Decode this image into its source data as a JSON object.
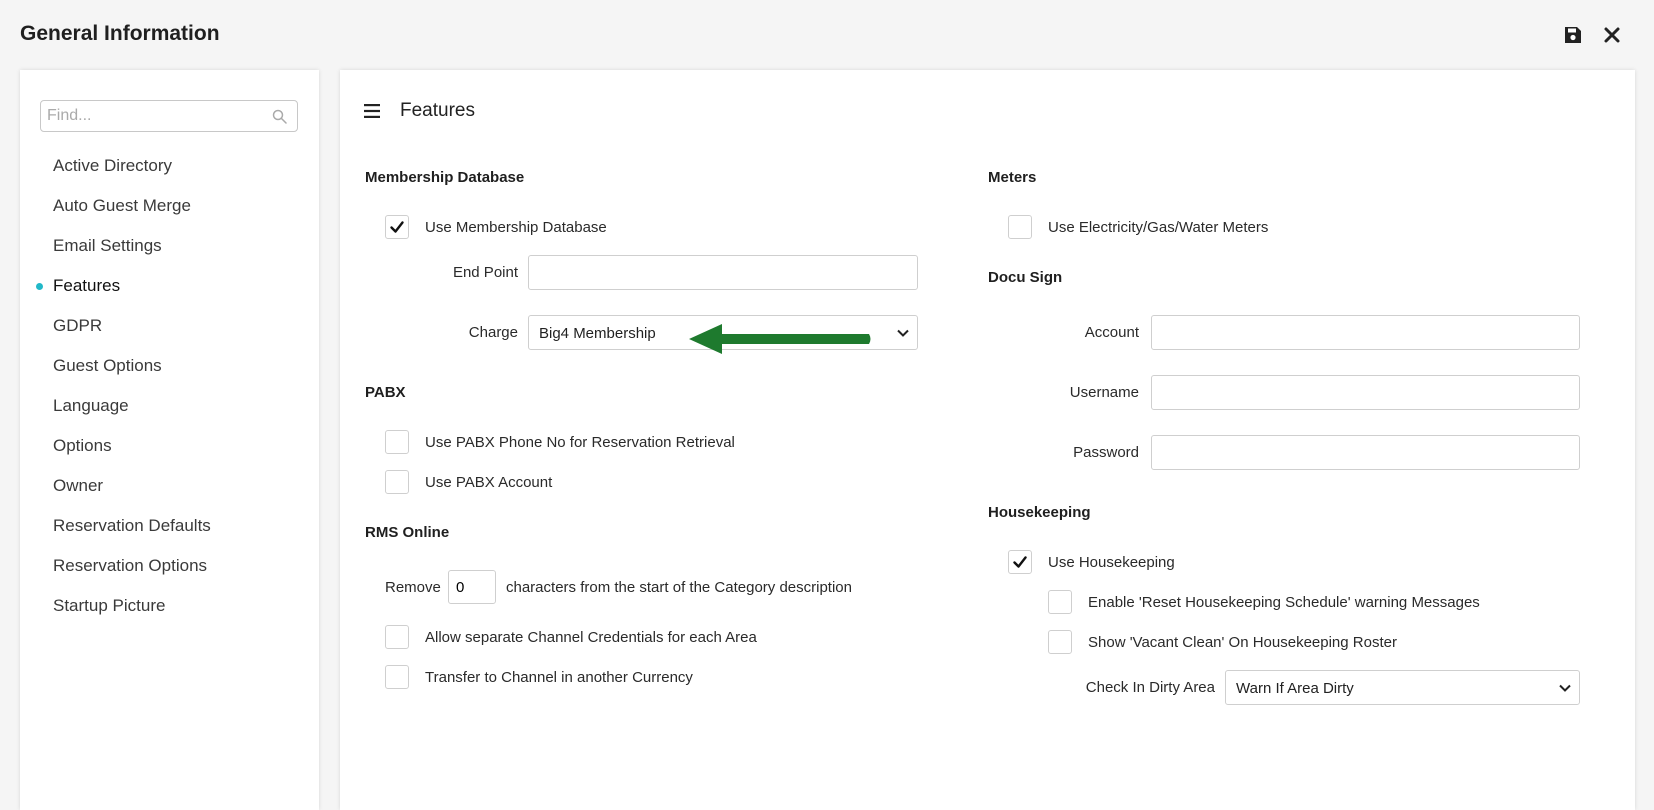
{
  "header": {
    "title": "General Information"
  },
  "sidebar": {
    "search_placeholder": "Find...",
    "items": [
      {
        "label": "Active Directory"
      },
      {
        "label": "Auto Guest Merge"
      },
      {
        "label": "Email Settings"
      },
      {
        "label": "Features",
        "active": true
      },
      {
        "label": "GDPR"
      },
      {
        "label": "Guest Options"
      },
      {
        "label": "Language"
      },
      {
        "label": "Options"
      },
      {
        "label": "Owner"
      },
      {
        "label": "Reservation Defaults"
      },
      {
        "label": "Reservation Options"
      },
      {
        "label": "Startup Picture"
      }
    ]
  },
  "main": {
    "title": "Features",
    "membership": {
      "heading": "Membership Database",
      "use_label": "Use Membership Database",
      "use_checked": true,
      "endpoint_label": "End Point",
      "endpoint_value": "",
      "charge_label": "Charge",
      "charge_value": "Big4 Membership"
    },
    "pabx": {
      "heading": "PABX",
      "phone_label": "Use PABX Phone No for Reservation Retrieval",
      "phone_checked": false,
      "account_label": "Use PABX Account",
      "account_checked": false
    },
    "rms_online": {
      "heading": "RMS Online",
      "remove_label": "Remove",
      "remove_value": "0",
      "remove_suffix": "characters from the start of the Category description",
      "separate_label": "Allow separate Channel Credentials for each Area",
      "separate_checked": false,
      "transfer_label": "Transfer to Channel in another Currency",
      "transfer_checked": false
    },
    "meters": {
      "heading": "Meters",
      "use_label": "Use Electricity/Gas/Water Meters",
      "use_checked": false
    },
    "docusign": {
      "heading": "Docu Sign",
      "account_label": "Account",
      "account_value": "",
      "username_label": "Username",
      "username_value": "",
      "password_label": "Password",
      "password_value": ""
    },
    "housekeeping": {
      "heading": "Housekeeping",
      "use_label": "Use Housekeeping",
      "use_checked": true,
      "reset_label": "Enable 'Reset Housekeeping Schedule' warning Messages",
      "reset_checked": false,
      "vacant_label": "Show 'Vacant Clean' On Housekeeping Roster",
      "vacant_checked": false,
      "dirty_label": "Check In Dirty Area",
      "dirty_value": "Warn If Area Dirty"
    }
  },
  "colors": {
    "accent": "#21b8c8",
    "arrow": "#1e7a2e",
    "background": "#f5f5f5"
  },
  "icons": {
    "save": "save-icon",
    "close": "close-icon",
    "search": "search-icon",
    "menu": "hamburger-menu-icon"
  }
}
